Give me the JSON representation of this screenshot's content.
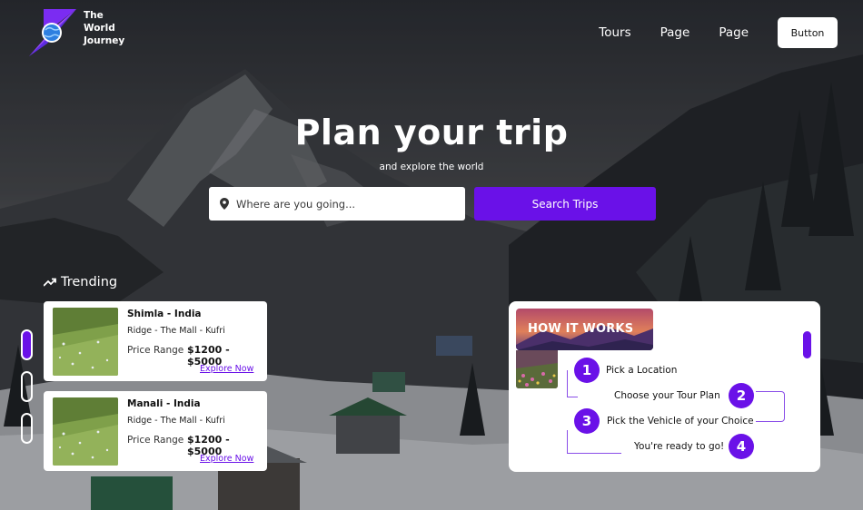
{
  "brand": {
    "name_line1": "The",
    "name_line2": "World",
    "name_line3": "Journey"
  },
  "nav": {
    "links": [
      "Tours",
      "Page",
      "Page"
    ],
    "button_label": "Button"
  },
  "hero": {
    "title": "Plan your trip",
    "subtitle": "and explore the world"
  },
  "search": {
    "placeholder": "Where are you going...",
    "button_label": "Search Trips"
  },
  "trending": {
    "title": "Trending",
    "cards": [
      {
        "name": "Shimla - India",
        "places": "Ridge - The Mall -  Kufri",
        "price_label": "Price Range",
        "price": "$1200 - $5000",
        "link": "Explore Now"
      },
      {
        "name": "Manali - India",
        "places": "Ridge - The Mall -  Kufri",
        "price_label": "Price Range",
        "price": "$1200 - $5000",
        "link": "Explore Now"
      }
    ]
  },
  "how_it_works": {
    "title": "HOW IT WORKS",
    "steps": [
      {
        "num": "1",
        "text": "Pick a Location"
      },
      {
        "num": "2",
        "text": "Choose your Tour Plan"
      },
      {
        "num": "3",
        "text": "Pick the Vehicle of your Choice"
      },
      {
        "num": "4",
        "text": "You're ready to go!"
      }
    ]
  },
  "colors": {
    "accent": "#6a11e8",
    "card_bg": "#ffffff"
  },
  "icons": {
    "location": "map-pin-icon",
    "trending": "trending-up-icon",
    "logo": "compass-globe-icon"
  }
}
